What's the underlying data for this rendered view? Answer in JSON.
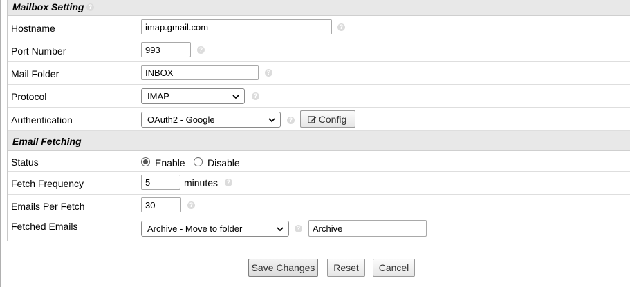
{
  "mailbox": {
    "title": "Mailbox Setting",
    "hostname": {
      "label": "Hostname",
      "value": "imap.gmail.com"
    },
    "port": {
      "label": "Port Number",
      "value": "993"
    },
    "folder": {
      "label": "Mail Folder",
      "value": "INBOX"
    },
    "protocol": {
      "label": "Protocol",
      "value": "IMAP"
    },
    "auth": {
      "label": "Authentication",
      "value": "OAuth2 - Google",
      "config_label": "Config"
    }
  },
  "fetching": {
    "title": "Email Fetching",
    "status": {
      "label": "Status",
      "enable": "Enable",
      "disable": "Disable",
      "selected": "Enable"
    },
    "frequency": {
      "label": "Fetch Frequency",
      "value": "5",
      "unit": "minutes"
    },
    "per_fetch": {
      "label": "Emails Per Fetch",
      "value": "30"
    },
    "fetched": {
      "label": "Fetched Emails",
      "action": "Archive - Move to folder",
      "folder": "Archive"
    }
  },
  "actions": {
    "save": "Save Changes",
    "reset": "Reset",
    "cancel": "Cancel"
  },
  "colors": {
    "header_bg": "#e8e8e8",
    "help_icon": "#dcdcdc"
  }
}
